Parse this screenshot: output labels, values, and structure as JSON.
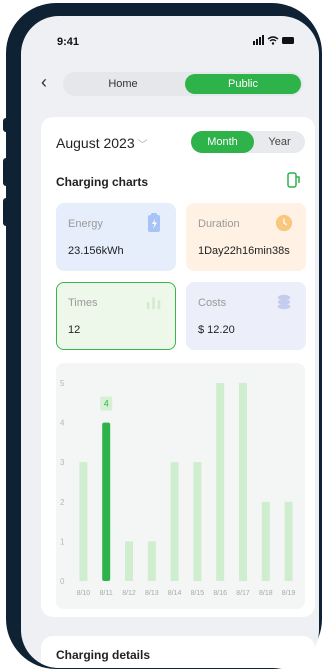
{
  "status": {
    "time": "9:41",
    "icons": "signal wifi battery"
  },
  "nav": {
    "back_icon": "chevron-left-icon",
    "tab_home": "Home",
    "tab_public": "Public"
  },
  "period": {
    "label": "August 2023",
    "toggle_month": "Month",
    "toggle_year": "Year"
  },
  "charging_charts": {
    "title": "Charging charts"
  },
  "stats": {
    "energy": {
      "label": "Energy",
      "value": "23.156kWh",
      "icon": "battery-icon"
    },
    "duration": {
      "label": "Duration",
      "value": "1Day22h16min38s",
      "icon": "clock-icon"
    },
    "times": {
      "label": "Times",
      "value": "12",
      "icon": "bar-chart-icon"
    },
    "costs": {
      "label": "Costs",
      "value": "$ 12.20",
      "icon": "coins-icon"
    }
  },
  "chart_data": {
    "type": "bar",
    "categories": [
      "8/10",
      "8/11",
      "8/12",
      "8/13",
      "8/14",
      "8/15",
      "8/16",
      "8/17",
      "8/18",
      "8/19"
    ],
    "values": [
      3,
      4,
      1,
      1,
      3,
      3,
      5,
      5,
      2,
      2
    ],
    "highlight_index": 1,
    "highlight_label": "4",
    "y_ticks": [
      "0",
      "1",
      "2",
      "3",
      "4",
      "5"
    ],
    "ylim": [
      0,
      5
    ],
    "colors": {
      "highlight": "#2db34a",
      "normal": "#cfeecf"
    }
  },
  "charging_details": {
    "title": "Charging details"
  }
}
